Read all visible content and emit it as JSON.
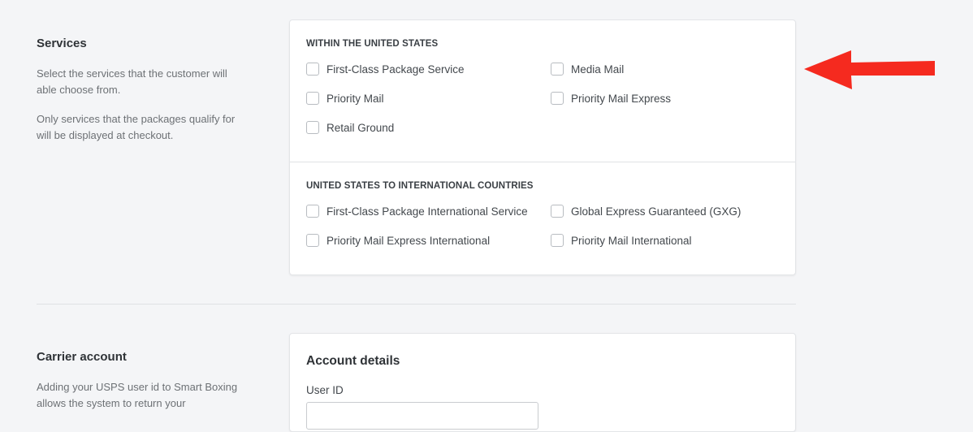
{
  "services": {
    "title": "Services",
    "desc1": "Select the services that the customer will able choose from.",
    "desc2": "Only services that the packages qualify for will be displayed at checkout.",
    "domestic": {
      "heading": "WITHIN THE UNITED STATES",
      "options": [
        "First-Class Package Service",
        "Media Mail",
        "Priority Mail",
        "Priority Mail Express",
        "Retail Ground"
      ]
    },
    "international": {
      "heading": "UNITED STATES TO INTERNATIONAL COUNTRIES",
      "options": [
        "First-Class Package International Service",
        "Global Express Guaranteed (GXG)",
        "Priority Mail Express International",
        "Priority Mail International"
      ]
    }
  },
  "carrier": {
    "title": "Carrier account",
    "desc": "Adding your USPS user id to Smart Boxing allows the system to return your",
    "card_title": "Account details",
    "user_id_label": "User ID",
    "user_id_value": ""
  },
  "annotation": {
    "arrow_color": "#f52a1f"
  }
}
